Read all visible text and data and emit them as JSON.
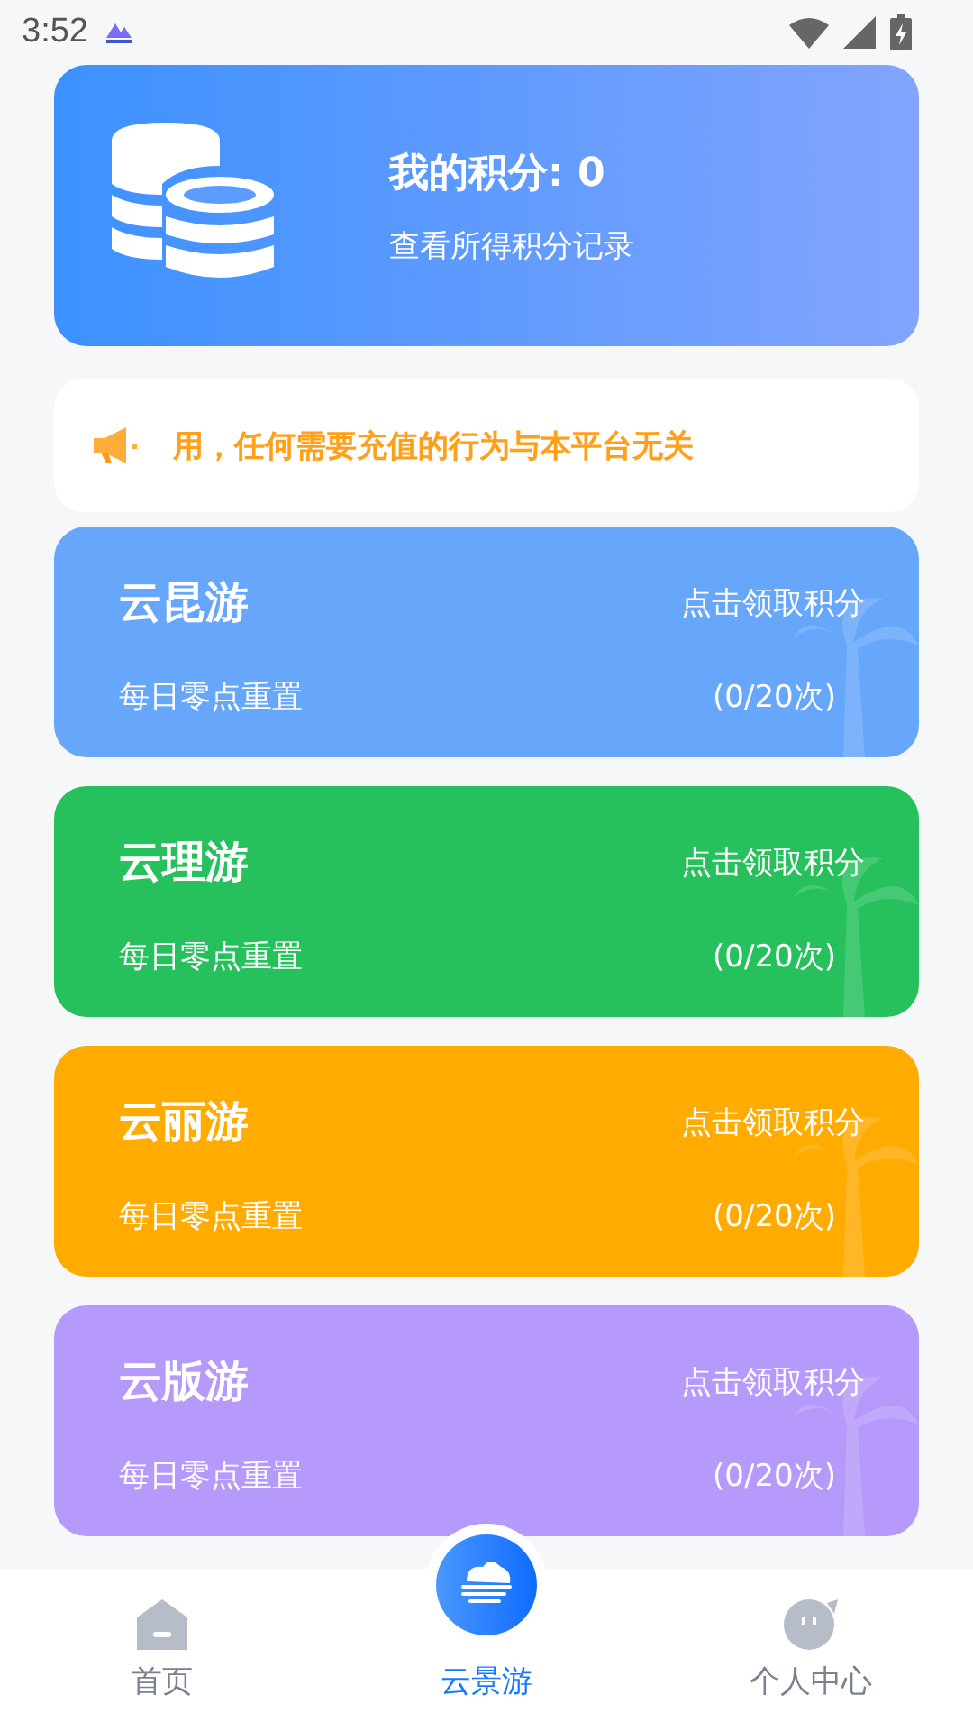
{
  "status_bar": {
    "time": "3:52"
  },
  "points_card": {
    "title": "我的积分: 0",
    "link": "查看所得积分记录"
  },
  "notice": {
    "text": "用，任何需要充值的行为与本平台无关"
  },
  "tasks": [
    {
      "name": "云昆游",
      "action": "点击领取积分",
      "note": "每日零点重置",
      "count": "(0/20次)",
      "color": "#66a6fb"
    },
    {
      "name": "云理游",
      "action": "点击领取积分",
      "note": "每日零点重置",
      "count": "(0/20次)",
      "color": "#26c05c"
    },
    {
      "name": "云丽游",
      "action": "点击领取积分",
      "note": "每日零点重置",
      "count": "(0/20次)",
      "color": "#ffab00"
    },
    {
      "name": "云版游",
      "action": "点击领取积分",
      "note": "每日零点重置",
      "count": "(0/20次)",
      "color": "#b59afb"
    }
  ],
  "tabs": [
    {
      "label": "首页",
      "kind": "home",
      "selected": false
    },
    {
      "label": "云景游",
      "kind": "center",
      "selected": true
    },
    {
      "label": "个人中心",
      "kind": "profile",
      "selected": false
    }
  ]
}
